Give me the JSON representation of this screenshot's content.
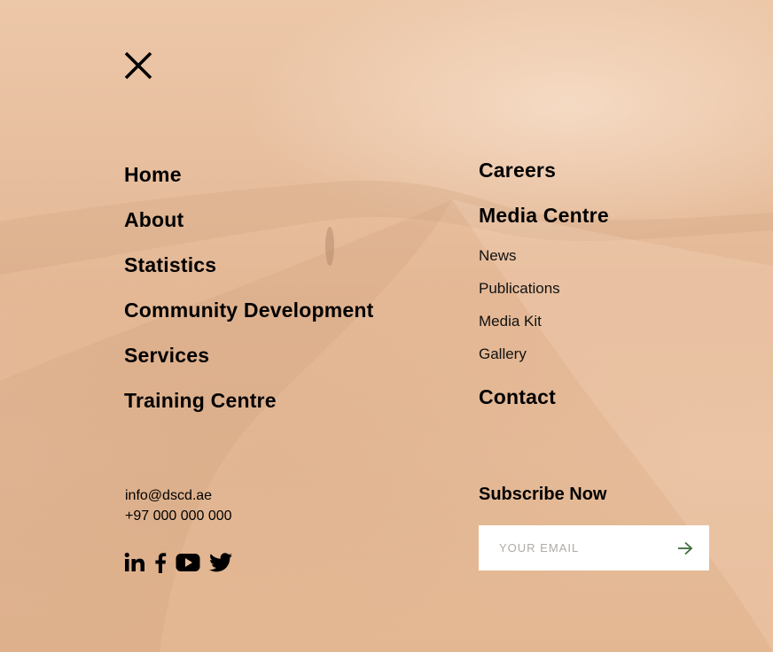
{
  "nav_main": [
    {
      "label": "Home"
    },
    {
      "label": "About"
    },
    {
      "label": "Statistics"
    },
    {
      "label": "Community Development"
    },
    {
      "label": "Services"
    },
    {
      "label": "Training Centre"
    }
  ],
  "nav_right": {
    "careers": "Careers",
    "media_centre": "Media Centre",
    "media_sub": [
      "News",
      "Publications",
      "Media Kit",
      "Gallery"
    ],
    "contact": "Contact"
  },
  "contact_info": {
    "email": "info@dscd.ae",
    "phone": "+97 000 000 000"
  },
  "social_icons": [
    "linkedin-icon",
    "facebook-icon",
    "youtube-icon",
    "twitter-icon"
  ],
  "subscribe": {
    "title": "Subscribe Now",
    "placeholder": "YOUR EMAIL"
  },
  "colors": {
    "background": "#e6bc9a",
    "text": "#000000",
    "arrow": "#3d6b3a"
  }
}
